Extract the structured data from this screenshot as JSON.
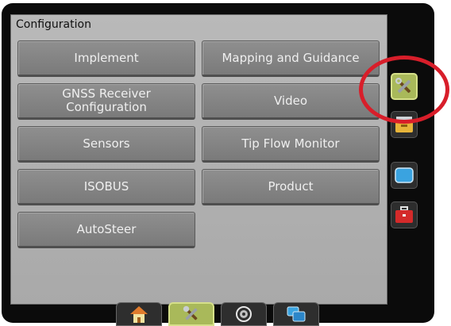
{
  "panel": {
    "title": "Configuration"
  },
  "buttons": {
    "implement": "Implement",
    "mapping": "Mapping and Guidance",
    "gnss_line1": "GNSS Receiver",
    "gnss_line2": "Configuration",
    "video": "Video",
    "sensors": "Sensors",
    "tip_flow": "Tip Flow Monitor",
    "isobus": "ISOBUS",
    "product": "Product",
    "autosteer": "AutoSteer"
  },
  "side_tabs": [
    {
      "icon": "tools-icon",
      "active": true
    },
    {
      "icon": "folder-icon",
      "active": false
    },
    {
      "icon": "display-icon",
      "active": false
    },
    {
      "icon": "toolbox-icon",
      "active": false
    }
  ],
  "bottom_tabs": [
    {
      "icon": "home-icon",
      "active": false
    },
    {
      "icon": "tools-icon",
      "active": true
    },
    {
      "icon": "gauge-icon",
      "active": false
    },
    {
      "icon": "screens-icon",
      "active": false
    }
  ],
  "colors": {
    "highlight_circle": "#d81e2a",
    "active_tab": "#a9b95a",
    "button": "#858585"
  }
}
